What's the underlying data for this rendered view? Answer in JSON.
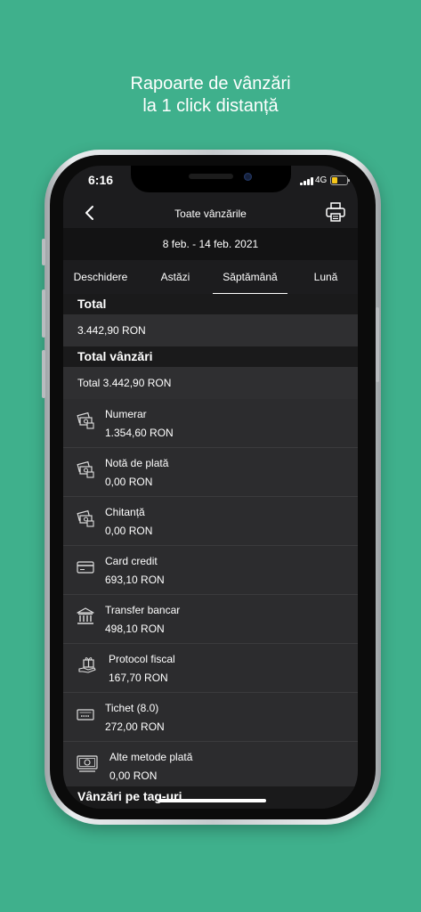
{
  "headline": {
    "line1": "Rapoarte de vânzări",
    "line2": "la 1 click distanță"
  },
  "status": {
    "time": "6:16",
    "network": "4G"
  },
  "nav": {
    "title": "Toate vânzările"
  },
  "date_range": "8 feb. - 14 feb. 2021",
  "tabs": [
    {
      "label": "Deschidere"
    },
    {
      "label": "Astăzi"
    },
    {
      "label": "Săptămână"
    },
    {
      "label": "Lună"
    }
  ],
  "active_tab": "Săptămână",
  "total": {
    "header": "Total",
    "value": "3.442,90 RON"
  },
  "sales": {
    "header": "Total vânzări",
    "summary": "Total 3.442,90 RON",
    "items": [
      {
        "label": "Numerar",
        "value": "1.354,60 RON",
        "icon": "cash-icon"
      },
      {
        "label": "Notă de plată",
        "value": "0,00 RON",
        "icon": "payment-note-icon"
      },
      {
        "label": "Chitanță",
        "value": "0,00 RON",
        "icon": "receipt-icon"
      },
      {
        "label": "Card credit",
        "value": "693,10 RON",
        "icon": "credit-card-icon"
      },
      {
        "label": "Transfer bancar",
        "value": "498,10 RON",
        "icon": "bank-icon"
      },
      {
        "label": "Protocol fiscal",
        "value": "167,70 RON",
        "icon": "gift-icon"
      },
      {
        "label": "Tichet (8.0)",
        "value": "272,00 RON",
        "icon": "ticket-icon"
      },
      {
        "label": "Alte metode plată",
        "value": "0,00 RON",
        "icon": "banknote-icon"
      }
    ]
  },
  "tags_header": "Vânzări pe tag-uri"
}
